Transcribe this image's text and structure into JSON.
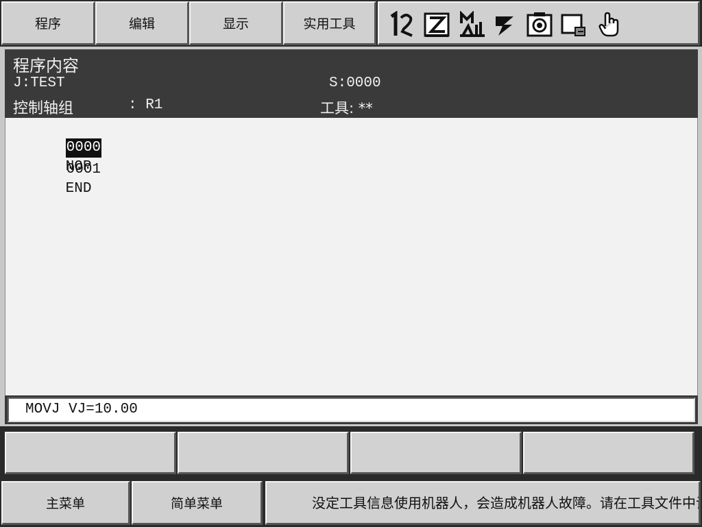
{
  "menubar": {
    "items": [
      {
        "label": "程序"
      },
      {
        "label": "编辑"
      },
      {
        "label": "显示"
      },
      {
        "label": "实用工具"
      }
    ],
    "status_icons": [
      "coordinate-mode-icon",
      "step-mode-icon",
      "manual-speed-icon",
      "servo-power-icon",
      "robot-status-icon",
      "page-icon",
      "hand-icon"
    ]
  },
  "program": {
    "title": "程序内容",
    "job_label": "J:TEST",
    "step_label": "S:0000",
    "group_label": "控制轴组",
    "group_value": ": R1",
    "tool_label": "工具: **",
    "lines": [
      {
        "no": "0000",
        "text": "NOP",
        "selected": true
      },
      {
        "no": "0001",
        "text": "END",
        "selected": false
      }
    ]
  },
  "input_line": {
    "value": "MOVJ VJ=10.00"
  },
  "softkeys": [
    {
      "label": ""
    },
    {
      "label": ""
    },
    {
      "label": ""
    },
    {
      "label": ""
    }
  ],
  "bottombar": {
    "main_menu": "主菜单",
    "simple_menu": "简单菜单",
    "message": "没定工具信息使用机器人，会造成机器人故障。请在工具文件中设定工具信息。"
  }
}
